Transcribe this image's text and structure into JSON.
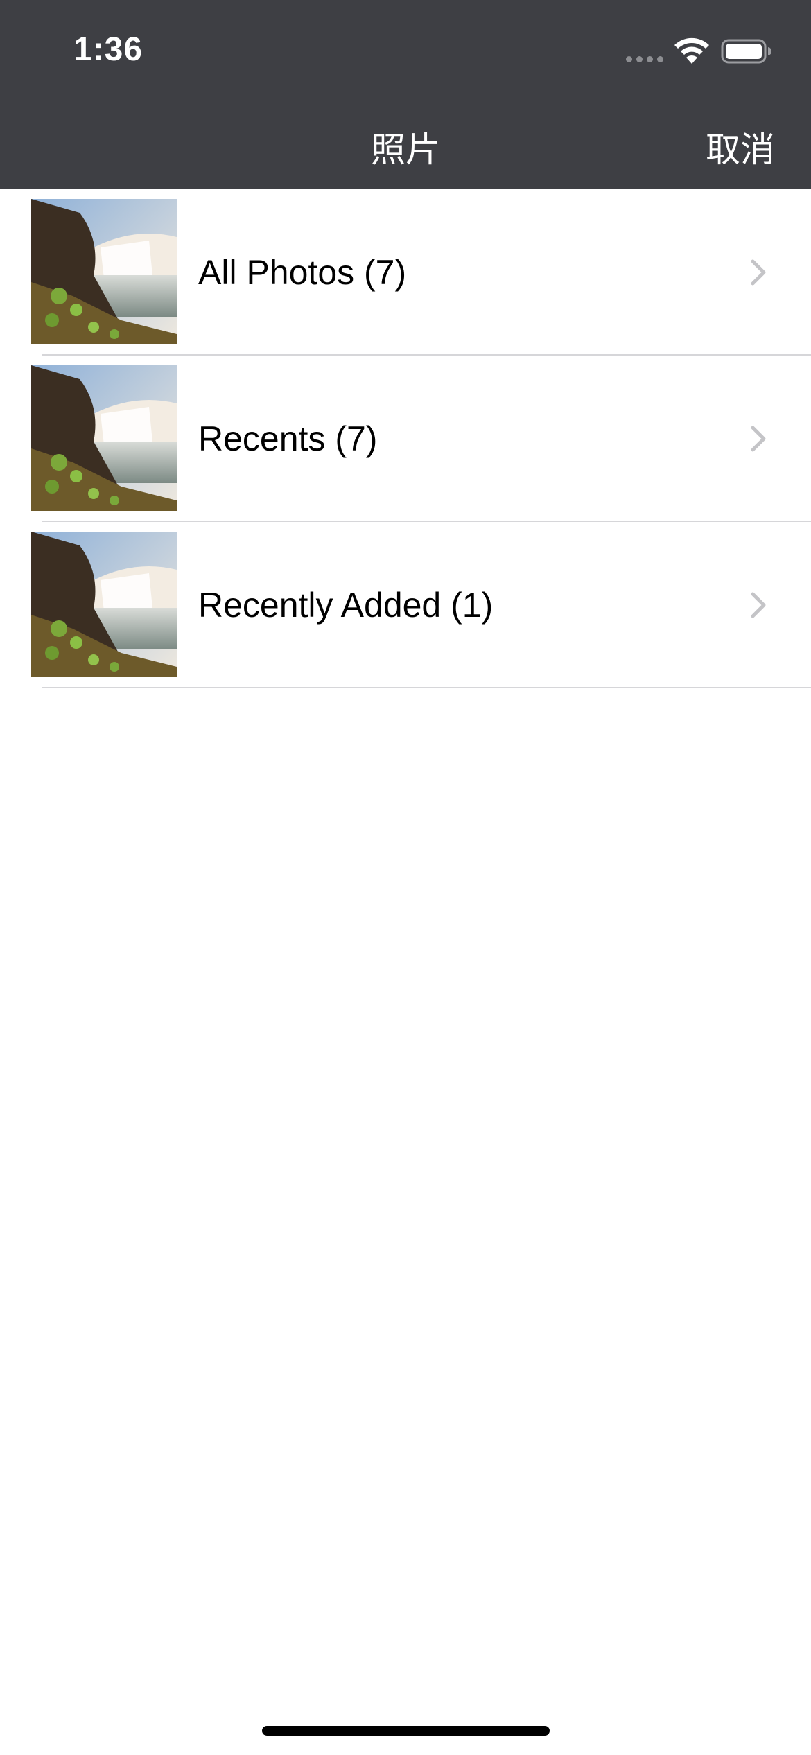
{
  "status_bar": {
    "time": "1:36"
  },
  "nav": {
    "title": "照片",
    "cancel_label": "取消"
  },
  "albums": [
    {
      "label": "All Photos (7)"
    },
    {
      "label": "Recents (7)"
    },
    {
      "label": "Recently Added (1)"
    }
  ],
  "colors": {
    "bar_background": "#3e3f44",
    "separator": "#d6d6d9",
    "chevron": "#c4c4c7"
  },
  "icons": {
    "wifi": "wifi-icon",
    "battery": "battery-icon",
    "chevron": "chevron-right-icon",
    "thumbnail": "waterfall-photo-thumbnail"
  }
}
